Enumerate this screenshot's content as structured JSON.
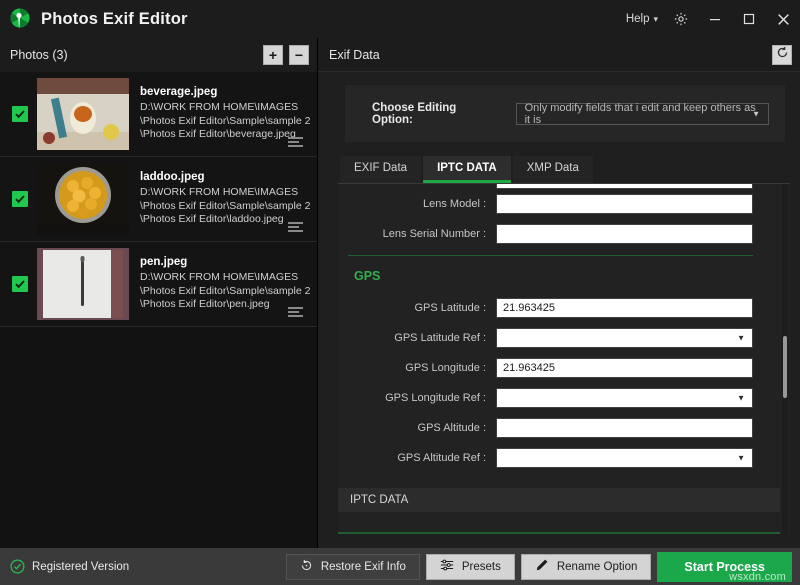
{
  "window": {
    "app_title": "Photos Exif Editor",
    "logo_icon": "aperture-icon",
    "help_label": "Help",
    "help_chevron": "chevron-down-icon",
    "settings_icon": "gear-icon",
    "minimize_icon": "minimize-icon",
    "maximize_icon": "maximize-icon",
    "close_icon": "close-icon",
    "accent_green": "#1aa84a"
  },
  "left_panel": {
    "header_title": "Photos (3)",
    "add_button_label": "+",
    "remove_button_label": "−",
    "photos": [
      {
        "checked": true,
        "name": "beverage.jpeg",
        "path_line1": "D:\\WORK FROM HOME\\IMAGES",
        "path_line2": "\\Photos Exif Editor\\Sample\\sample 2",
        "path_line3": "\\Photos Exif Editor\\beverage.jpeg",
        "menu_icon": "hamburger-icon"
      },
      {
        "checked": true,
        "name": "laddoo.jpeg",
        "path_line1": "D:\\WORK FROM HOME\\IMAGES",
        "path_line2": "\\Photos Exif Editor\\Sample\\sample 2",
        "path_line3": "\\Photos Exif Editor\\laddoo.jpeg",
        "menu_icon": "hamburger-icon"
      },
      {
        "checked": true,
        "name": "pen.jpeg",
        "path_line1": "D:\\WORK FROM HOME\\IMAGES",
        "path_line2": "\\Photos Exif Editor\\Sample\\sample 2",
        "path_line3": "\\Photos Exif Editor\\pen.jpeg",
        "menu_icon": "hamburger-icon"
      }
    ]
  },
  "right_panel": {
    "header_title": "Exif Data",
    "refresh_icon": "refresh-icon",
    "editing_option": {
      "label": "Choose Editing Option:",
      "selected": "Only modify fields that i edit and keep others as it is",
      "caret_icon": "chevron-down-icon"
    },
    "tabs": [
      {
        "label": "EXIF Data",
        "active": false
      },
      {
        "label": "IPTC DATA",
        "active": true
      },
      {
        "label": "XMP Data",
        "active": false
      }
    ],
    "fields": [
      {
        "label": "",
        "value": "",
        "type": "text",
        "clipped": true
      },
      {
        "label": "Lens Model :",
        "value": "",
        "type": "text"
      },
      {
        "label": "Lens Serial Number :",
        "value": "",
        "type": "text"
      }
    ],
    "gps_group_title": "GPS",
    "gps_fields": [
      {
        "label": "GPS Latitude :",
        "value": "21.963425",
        "type": "text"
      },
      {
        "label": "GPS Latitude Ref :",
        "value": "",
        "type": "select"
      },
      {
        "label": "GPS Longitude :",
        "value": "21.963425",
        "type": "text"
      },
      {
        "label": "GPS Longitude Ref :",
        "value": "",
        "type": "select"
      },
      {
        "label": "GPS Altitude :",
        "value": "",
        "type": "text"
      },
      {
        "label": "GPS Altitude Ref :",
        "value": "",
        "type": "select"
      }
    ],
    "section_bar_label": "IPTC DATA"
  },
  "bottom_bar": {
    "registered_label": "Registered Version",
    "registered_icon": "check-circle-icon",
    "restore_label": "Restore Exif Info",
    "restore_icon": "restore-icon",
    "presets_label": "Presets",
    "presets_icon": "sliders-icon",
    "rename_label": "Rename Option",
    "rename_icon": "pencil-icon",
    "start_label": "Start Process"
  },
  "watermark": "wsxdn.com"
}
